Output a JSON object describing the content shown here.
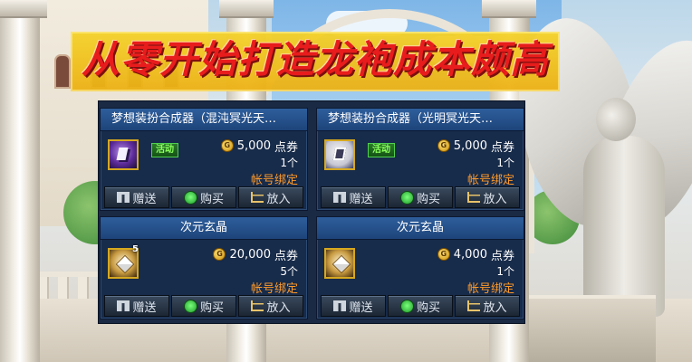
{
  "banner": {
    "text": "从零开始打造龙袍成本颇高"
  },
  "shop": {
    "items": [
      {
        "title": "梦想装扮合成器（混沌冥光天…",
        "icon": "purple-crystal-icon",
        "badge": "活动",
        "currency_icon": "G",
        "price": "5,000",
        "currency": "点券",
        "quantity": "1个",
        "binding": "帐号绑定",
        "stack_count": "",
        "buttons": {
          "gift": "赠送",
          "buy": "购买",
          "cart": "放入"
        }
      },
      {
        "title": "梦想装扮合成器（光明冥光天…",
        "icon": "white-crystal-icon",
        "badge": "活动",
        "currency_icon": "G",
        "price": "5,000",
        "currency": "点券",
        "quantity": "1个",
        "binding": "帐号绑定",
        "stack_count": "",
        "buttons": {
          "gift": "赠送",
          "buy": "购买",
          "cart": "放入"
        }
      },
      {
        "title": "次元玄晶",
        "icon": "dimension-crystal-cube-icon",
        "badge": "",
        "currency_icon": "G",
        "price": "20,000",
        "currency": "点券",
        "quantity": "5个",
        "binding": "帐号绑定",
        "stack_count": "5",
        "buttons": {
          "gift": "赠送",
          "buy": "购买",
          "cart": "放入"
        }
      },
      {
        "title": "次元玄晶",
        "icon": "dimension-crystal-cube-icon",
        "badge": "",
        "currency_icon": "G",
        "price": "4,000",
        "currency": "点券",
        "quantity": "1个",
        "binding": "帐号绑定",
        "stack_count": "",
        "buttons": {
          "gift": "赠送",
          "buy": "购买",
          "cart": "放入"
        }
      }
    ]
  }
}
